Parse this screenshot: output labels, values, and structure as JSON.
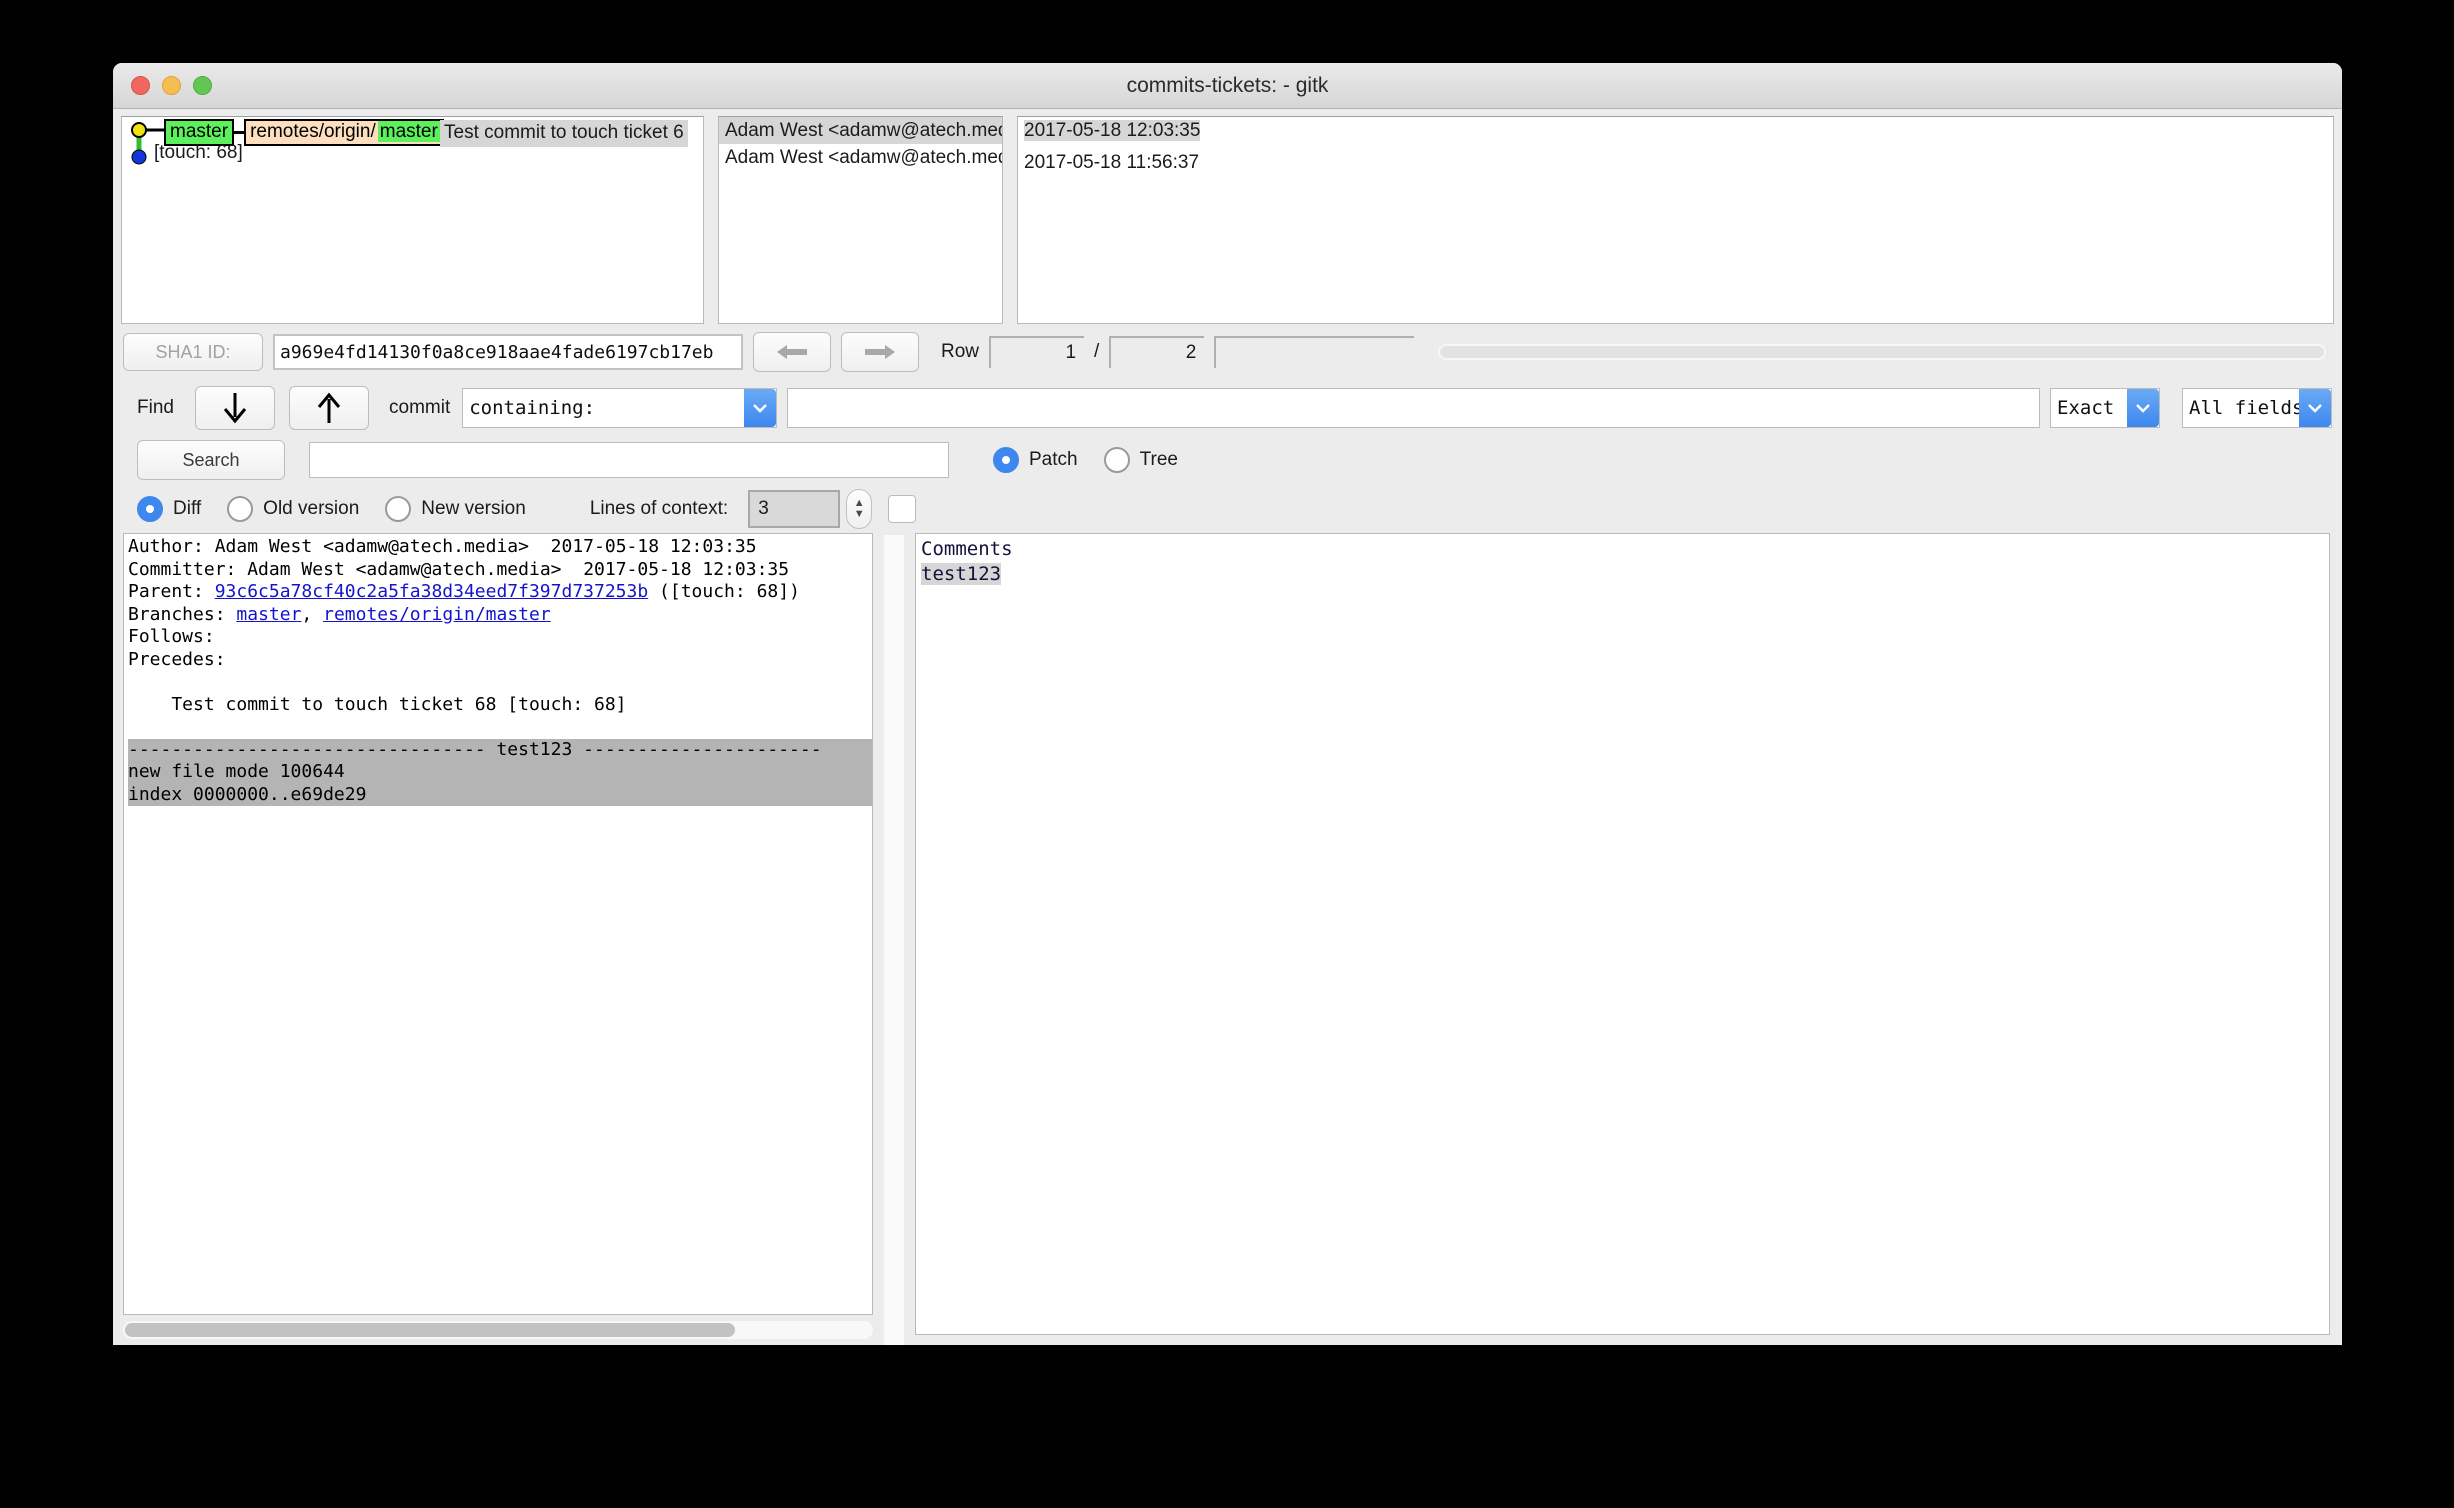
{
  "window": {
    "title": "commits-tickets:  - gitk",
    "traffic_lights": [
      "close",
      "minimize",
      "zoom"
    ]
  },
  "commit_list": {
    "rows": [
      {
        "refs": [
          {
            "type": "local",
            "label": "master"
          },
          {
            "type": "remote",
            "label": "remotes/origin/",
            "tail": "master"
          }
        ],
        "subject": "Test commit to touch ticket 6",
        "author": "Adam West <adamw@atech.medi",
        "date": "2017-05-18 12:03:35",
        "selected": true,
        "node_color": "#f3e211"
      },
      {
        "subject": "[touch: 68]",
        "author": "Adam West <adamw@atech.medi",
        "date": "2017-05-18 11:56:37",
        "selected": false,
        "node_color": "#1436d6"
      }
    ]
  },
  "sha_row": {
    "sha_label": "SHA1 ID:",
    "sha_value": "a969e4fd14130f0a8ce918aae4fade6197cb17eb",
    "back_icon": "arrow-left-icon",
    "forward_icon": "arrow-right-icon",
    "row_label": "Row",
    "row_current": "1",
    "row_separator": "/",
    "row_total": "2",
    "row_extra": ""
  },
  "find_row": {
    "find_label": "Find",
    "down_icon": "arrow-down-icon",
    "up_icon": "arrow-up-icon",
    "commit_label": "commit",
    "mode": "containing:",
    "query": "",
    "match_type": "Exact",
    "field_scope": "All fields"
  },
  "search_row": {
    "search_label": "Search",
    "search_value": "",
    "patch_label": "Patch",
    "tree_label": "Tree",
    "view_mode": "Patch"
  },
  "options_row": {
    "diff_label": "Diff",
    "old_version_label": "Old version",
    "new_version_label": "New version",
    "diff_mode": "Diff",
    "lines_of_context_label": "Lines of context:",
    "lines_of_context_value": "3",
    "ignore_space_checked": false
  },
  "diff_panel": {
    "author_label": "Author:",
    "author_value": "Adam West <adamw@atech.media>",
    "author_date": "2017-05-18 12:03:35",
    "committer_label": "Committer:",
    "committer_value": "Adam West <adamw@atech.media>",
    "committer_date": "2017-05-18 12:03:35",
    "parent_label": "Parent:",
    "parent_sha": "93c6c5a78cf40c2a5fa38d34eed7f397d737253b",
    "parent_subject": "([touch: 68])",
    "branches_label": "Branches:",
    "branch_1": "master",
    "branch_sep": ", ",
    "branch_2": "remotes/origin/master",
    "follows_label": "Follows:",
    "precedes_label": "Precedes:",
    "commit_message": "    Test commit to touch ticket 68 [touch: 68]",
    "hunk_header": "--------------------------------- test123 ----------------------",
    "hunk_line_1": "new file mode 100644",
    "hunk_line_2": "index 0000000..e69de29"
  },
  "comment_panel": {
    "header": "Comments",
    "file": "test123"
  },
  "colors": {
    "accent": "#3d87ef",
    "local_ref": "#5cf05c",
    "remote_ref": "#fddfc0",
    "selection": "#d6d6d6",
    "hunk_bg": "#b4b4b4",
    "link": "#1414cf"
  }
}
